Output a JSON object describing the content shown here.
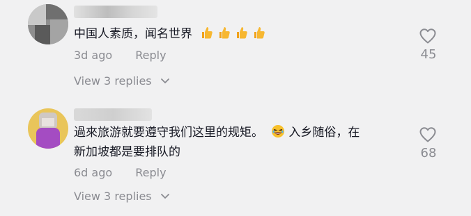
{
  "comments": [
    {
      "text": "中国人素质，闻名世界",
      "emojis": [
        "thumbs-up-icon",
        "thumbs-up-icon",
        "thumbs-up-icon",
        "thumbs-up-icon"
      ],
      "time": "3d ago",
      "reply_label": "Reply",
      "view_replies": "View 3 replies",
      "likes": "45"
    },
    {
      "text_line1_before": "過來旅游就要遵守我们这里的规矩。",
      "emoji": "laughing-face-icon",
      "text_line1_after": "入乡随俗，在",
      "text_line2": "新加坡都是要排队的",
      "time": "6d ago",
      "reply_label": "Reply",
      "view_replies": "View 3 replies",
      "likes": "68"
    }
  ],
  "colors": {
    "background": "#f1f1f2",
    "text": "#161823",
    "secondary": "#8a8b91"
  }
}
